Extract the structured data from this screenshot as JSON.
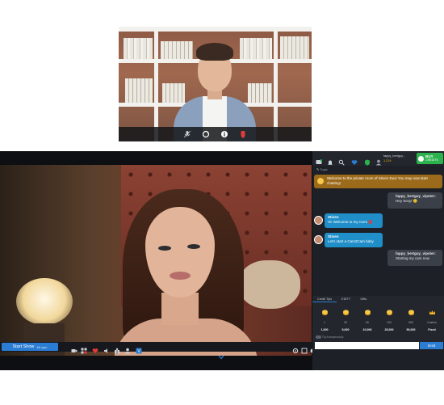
{
  "cam2cam": {
    "controls": [
      {
        "name": "mic-icon"
      },
      {
        "name": "switch-camera-icon"
      },
      {
        "name": "info-icon"
      },
      {
        "name": "stop-camera-icon"
      }
    ]
  },
  "toolbar": {
    "start_show_label": "Start Show",
    "start_show_sub": "46 cpm"
  },
  "chat": {
    "user_name": "fappy_bertguy...",
    "user_credits": "1,219",
    "buy_label": "BUY",
    "buy_sub": "CREDITS",
    "topic_label": "Topic",
    "welcome_text": "Welcome to the private room of Stiven Dux! You may now start chatting!",
    "messages": [
      {
        "direction": "out",
        "name": "fappy_bertguy_vipster:",
        "text": "Hey Sexy! 😊"
      },
      {
        "direction": "in",
        "name": "Stiven",
        "text": "Hi! Welcome to my room 💋"
      },
      {
        "direction": "in",
        "name": "Stiven",
        "text": "Let's start a Cam2Cam baby"
      },
      {
        "direction": "out",
        "name": "fappy_bertguy_vipster:",
        "text": "Starting my cam now"
      }
    ],
    "tip_tabs": [
      "Credit Tips",
      "EDITY",
      "Gifts"
    ],
    "tips": [
      {
        "label": "1",
        "amount": "1,000",
        "color": "#f2b01e"
      },
      {
        "label": "25",
        "amount": "5,000",
        "color": "#f2b01e"
      },
      {
        "label": "50",
        "amount": "10,000",
        "color": "#f2b01e"
      },
      {
        "label": "100",
        "amount": "25,000",
        "color": "#f2b01e"
      },
      {
        "label": "500",
        "amount": "50,000",
        "color": "#f2b01e"
      },
      {
        "label": "Custom",
        "amount": "Fixed",
        "color": "#f2b01e"
      }
    ],
    "anon_label": "Tip Anonymously",
    "send_label": "Send",
    "input_placeholder": ""
  },
  "colors": {
    "accent_blue": "#2b7cd3",
    "buy_green": "#2bb24c",
    "welcome_amber": "#9b6b1b",
    "bubble_in": "#1f8ec9",
    "bubble_out": "#3b3f47"
  }
}
